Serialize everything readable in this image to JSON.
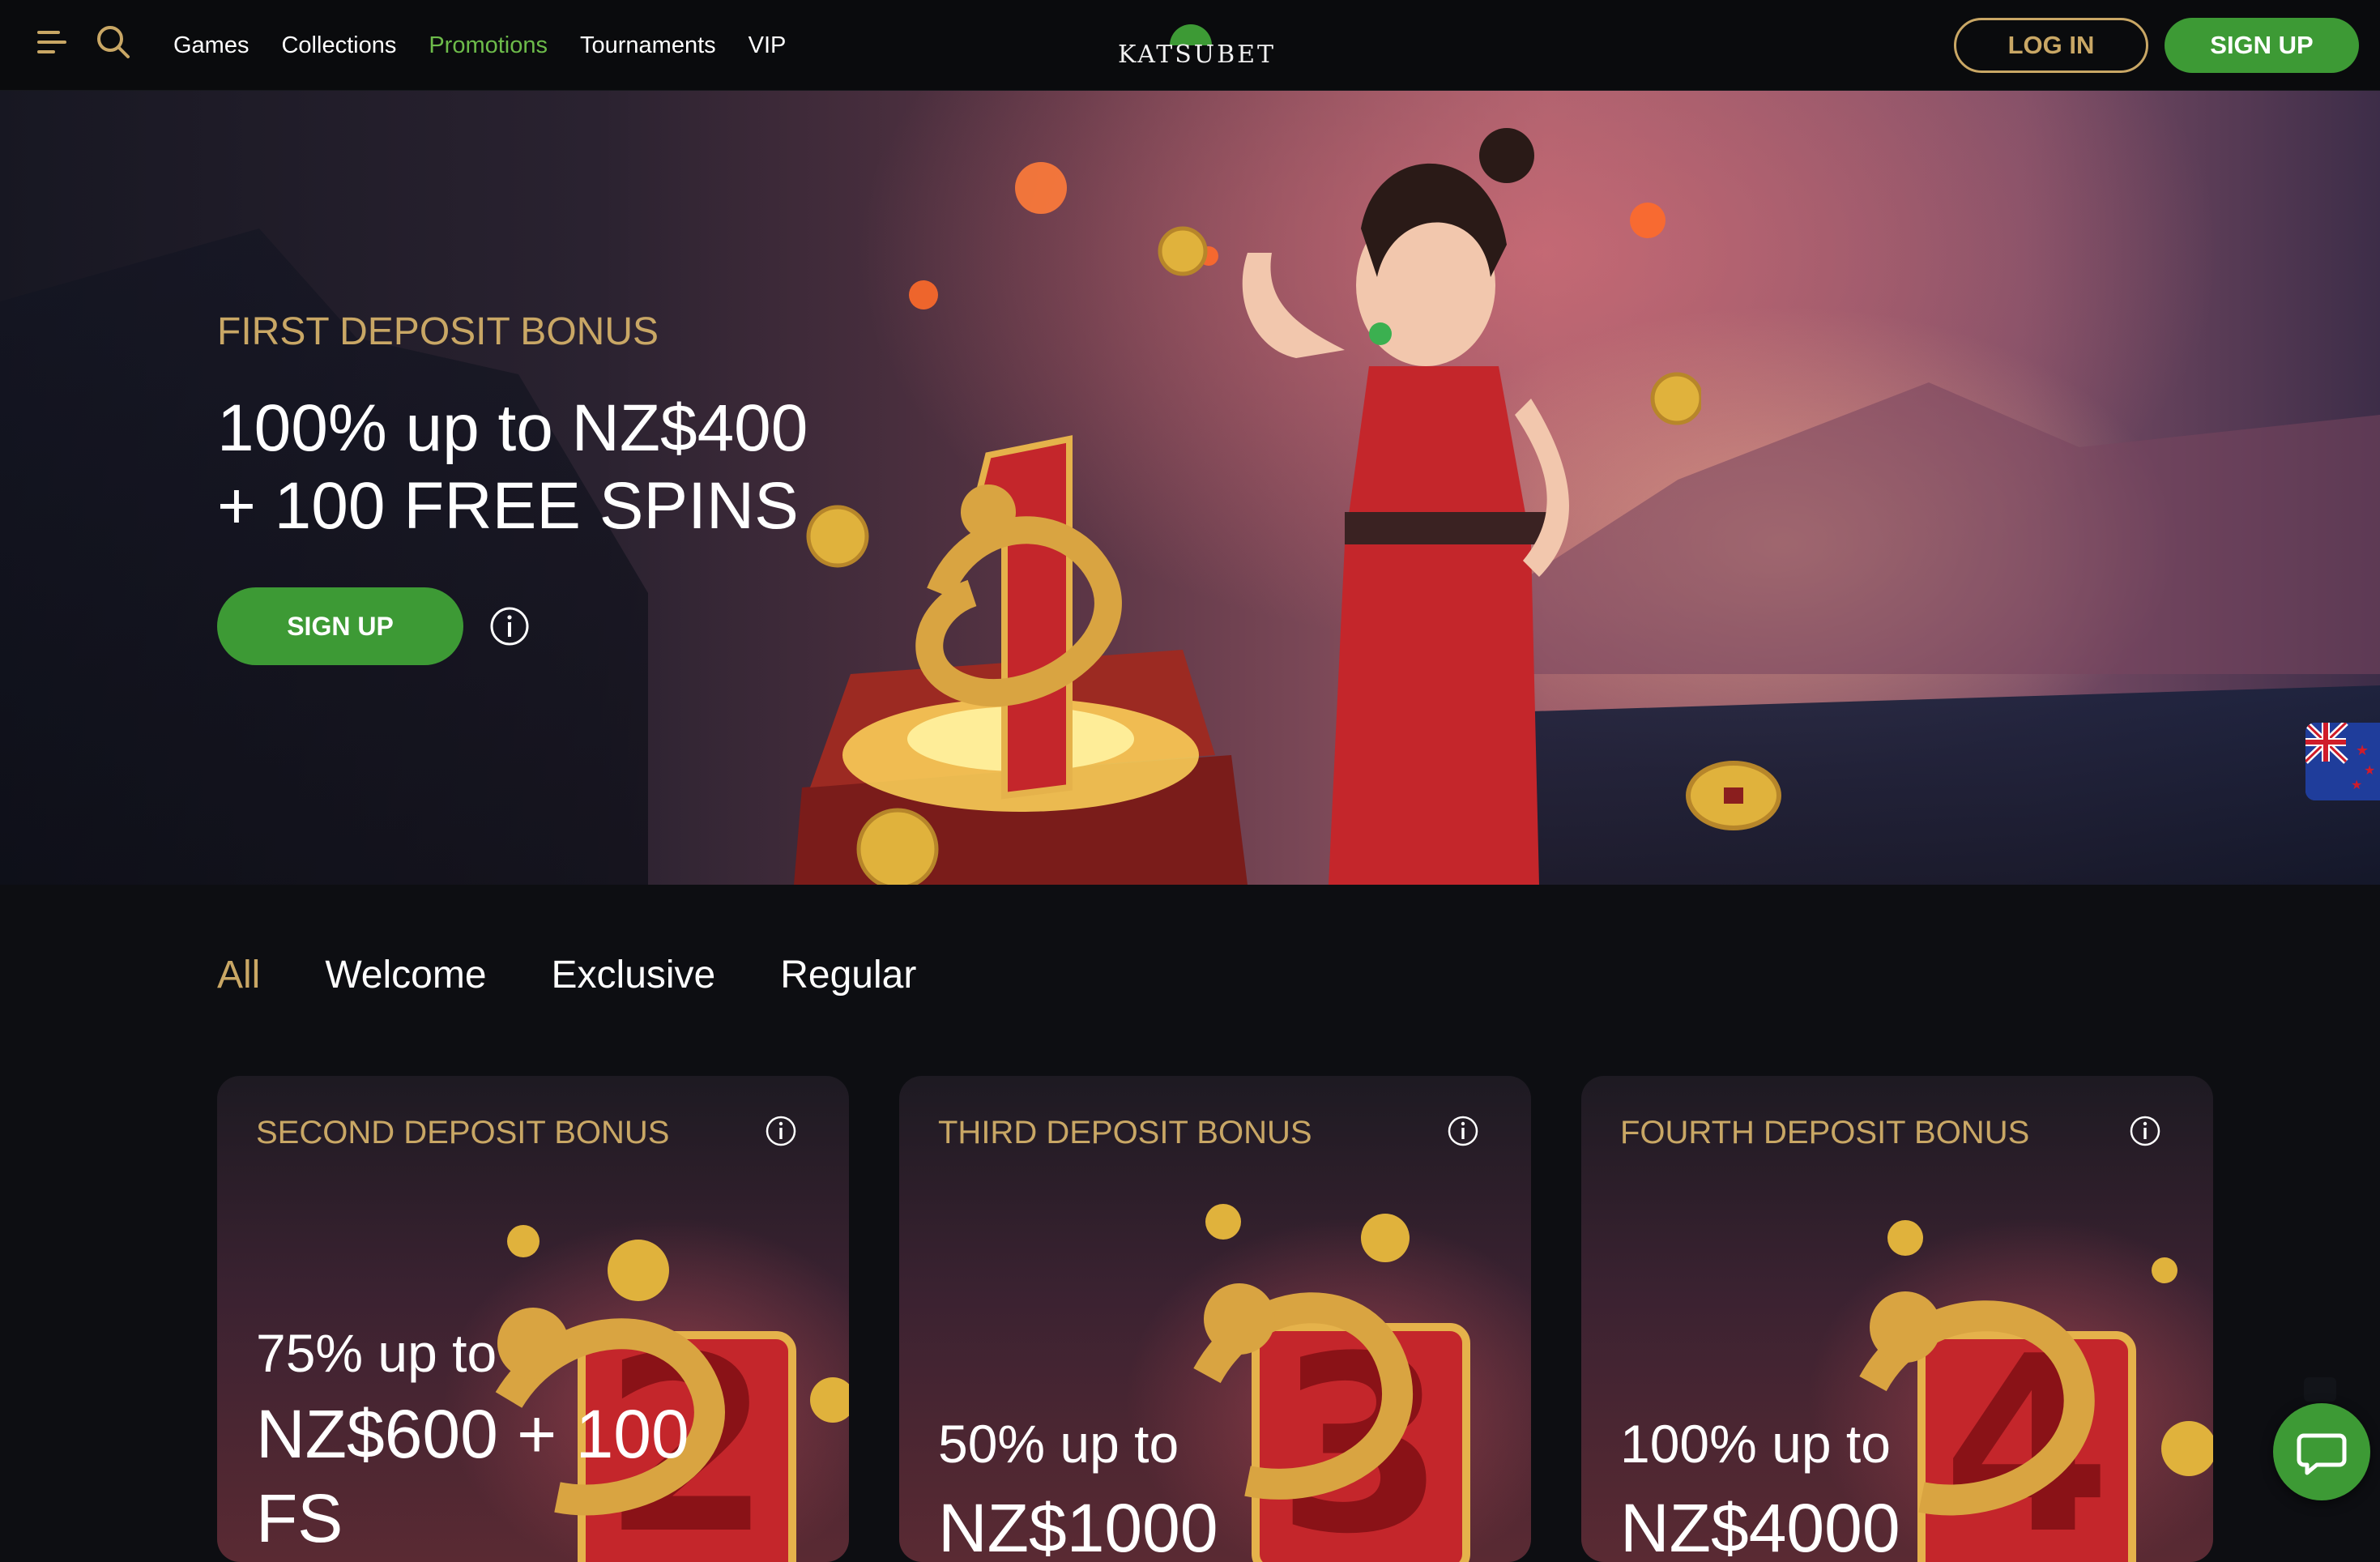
{
  "header": {
    "menu_icon": "hamburger-menu-icon",
    "search_icon": "search-icon",
    "nav": [
      {
        "label": "Games",
        "active": false
      },
      {
        "label": "Collections",
        "active": false
      },
      {
        "label": "Promotions",
        "active": true
      },
      {
        "label": "Tournaments",
        "active": false
      },
      {
        "label": "VIP",
        "active": false
      }
    ],
    "logo_text": "KATSUBET",
    "login_label": "LOG IN",
    "signup_label": "SIGN UP"
  },
  "hero": {
    "kicker": "FIRST DEPOSIT BONUS",
    "title_line1": "100% up to NZ$400",
    "title_line2": "+ 100 FREE SPINS",
    "signup_label": "SIGN UP",
    "info_icon": "info-icon"
  },
  "language_flag": "new-zealand-flag-icon",
  "tabs": [
    {
      "label": "All",
      "active": true
    },
    {
      "label": "Welcome",
      "active": false
    },
    {
      "label": "Exclusive",
      "active": false
    },
    {
      "label": "Regular",
      "active": false
    }
  ],
  "cards": [
    {
      "kicker": "SECOND DEPOSIT BONUS",
      "line1": "75% up to",
      "line2": "NZ$600 + 100",
      "line3": "FS",
      "digit": "2"
    },
    {
      "kicker": "THIRD DEPOSIT BONUS",
      "line1": "50% up to",
      "line2": "NZ$1000",
      "line3": "",
      "digit": "3"
    },
    {
      "kicker": "FOURTH DEPOSIT BONUS",
      "line1": "100% up to",
      "line2": "NZ$4000",
      "line3": "",
      "digit": "4"
    }
  ],
  "chat_icon": "chat-bubble-icon",
  "colors": {
    "accent_green": "#3d9a35",
    "accent_gold": "#c9a765",
    "nav_active": "#6dbb4a",
    "background": "#0d0e12"
  }
}
